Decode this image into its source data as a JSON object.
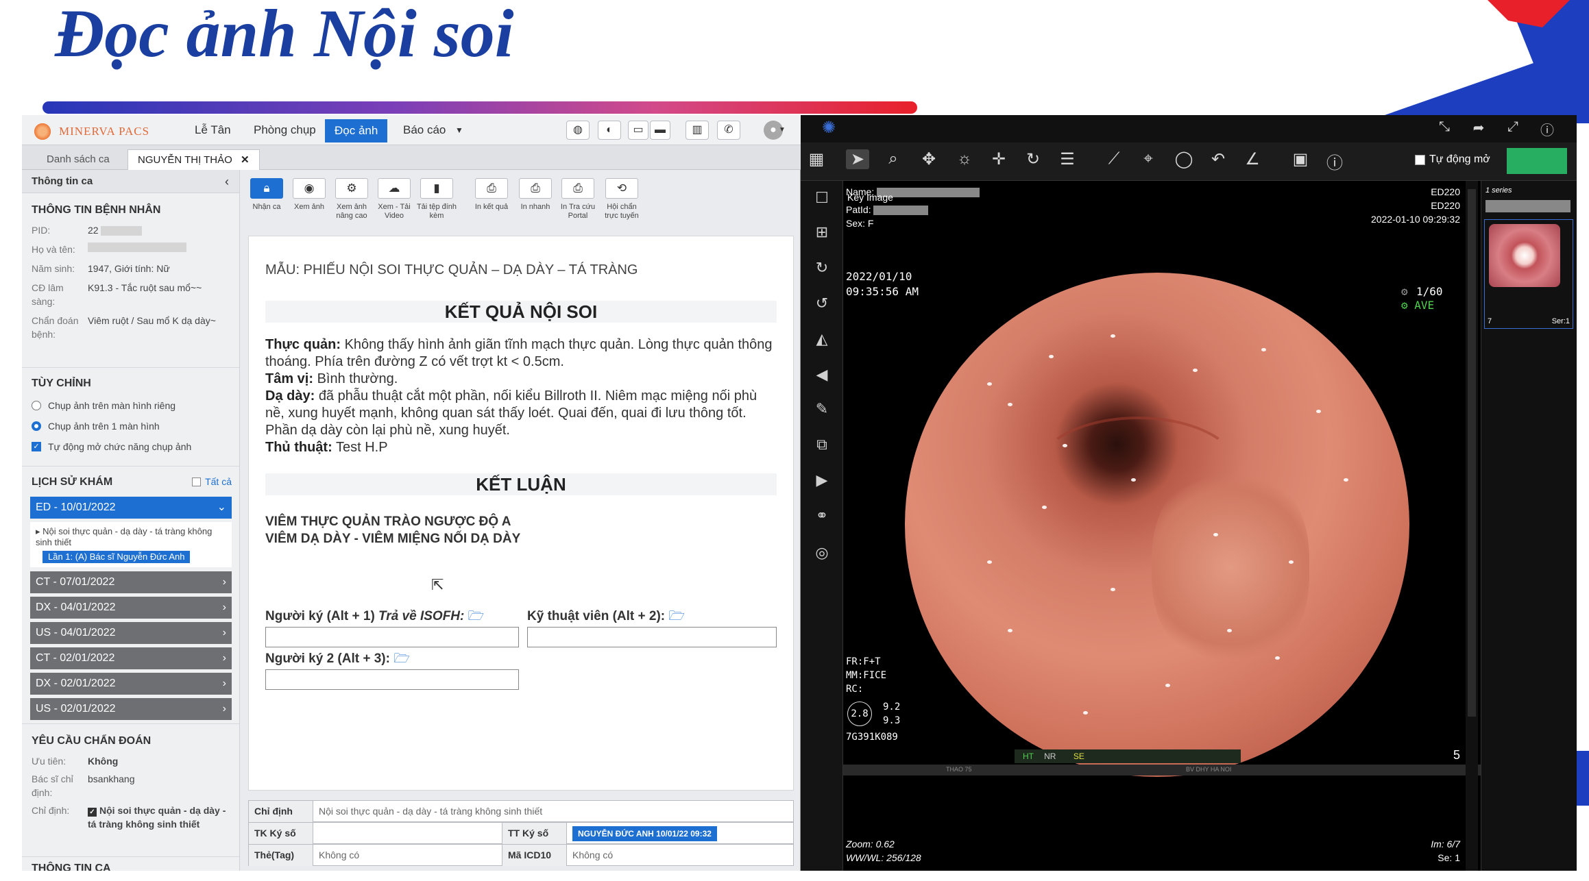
{
  "slide": {
    "title": "Đọc ảnh Nội soi"
  },
  "pacs": {
    "brand": "MINERVA PACS",
    "nav": [
      "Lễ Tân",
      "Phòng chụp",
      "Đọc ảnh",
      "Báo cáo"
    ],
    "nav_active": "Đọc ảnh",
    "tabs": {
      "list": "Danh sách ca",
      "patient": "NGUYỄN THỊ THẢO",
      "close": "✕"
    },
    "left": {
      "case_info": "Thông tin ca",
      "patient_section": "THÔNG TIN BỆNH NHÂN",
      "pid_label": "PID:",
      "pid": "22",
      "name_label": "Họ và tên:",
      "birth_label": "Năm sinh:",
      "birth": "1947, Giới tính: Nữ",
      "clin_dx_label": "CĐ lâm sàng:",
      "clin_dx": "K91.3 - Tắc ruột sau mổ~~",
      "dx_label": "Chẩn đoán bệnh:",
      "dx": "Viêm ruột / Sau mổ K dạ dày~",
      "options_section": "TÙY CHỈNH",
      "opt1": "Chụp ảnh trên màn hình riêng",
      "opt2": "Chụp ảnh trên 1 màn hình",
      "opt3": "Tự động mở chức năng chụp ảnh",
      "history_section": "LỊCH SỬ KHÁM",
      "history_all": "Tất cả",
      "history_active": "ED - 10/01/2022",
      "history_proc": "Nội soi thực quản - dạ dày - tá tràng không sinh thiết",
      "history_sub": "Lần 1: (A) Bác sĩ Nguyễn Đức Anh",
      "history": [
        "CT - 07/01/2022",
        "DX - 04/01/2022",
        "US - 04/01/2022",
        "CT - 02/01/2022",
        "DX - 02/01/2022",
        "US - 02/01/2022"
      ],
      "request_section": "YÊU CẦU CHẨN ĐOÁN",
      "priority_label": "Ưu tiên:",
      "priority": "Không",
      "doctor_label": "Bác sĩ chỉ định:",
      "doctor": "bsankhang",
      "order_label": "Chỉ định:",
      "order": "Nội soi thực quản - dạ dày - tá tràng không sinh thiết",
      "case_section": "THÔNG TIN CA"
    },
    "toolbar": [
      {
        "label": "Nhận ca",
        "icon": "lock-icon"
      },
      {
        "label": "Xem ảnh",
        "icon": "eye-icon"
      },
      {
        "label": "Xem ảnh nâng cao",
        "icon": "gear-icon"
      },
      {
        "label": "Xem - Tải Video",
        "icon": "cloud-upload-icon"
      },
      {
        "label": "Tải tệp đính kèm",
        "icon": "file-icon"
      },
      {
        "label": "In kết quả",
        "icon": "print-icon"
      },
      {
        "label": "In nhanh",
        "icon": "print-icon"
      },
      {
        "label": "In Tra cứu Portal",
        "icon": "print-icon"
      },
      {
        "label": "Hội chẩn trực tuyến",
        "icon": "sync-icon"
      }
    ],
    "report": {
      "template": "MẪU: PHIẾU NỘI SOI THỰC QUẢN – DẠ DÀY – TÁ TRÀNG",
      "result_title": "KẾT QUẢ NỘI SOI",
      "esophagus_label": "Thực quản:",
      "esophagus": "Không thấy hình ảnh giãn tĩnh mạch thực quản. Lòng thực quản thông thoáng. Phía trên đường Z có vết trợt kt < 0.5cm.",
      "cardia_label": "Tâm vị:",
      "cardia": "Bình thường.",
      "stomach_label": "Dạ dày:",
      "stomach": "đã phẫu thuật cắt một phần, nối kiểu Billroth II. Niêm mạc miệng nối phù nề, xung huyết mạnh, không quan sát thấy loét. Quai đến, quai đi lưu thông tốt. Phần dạ dày còn lại phù nề, xung huyết.",
      "procedure_label": "Thủ thuật:",
      "procedure": "Test H.P",
      "conclusion_title": "KẾT LUẬN",
      "conclusion1": "VIÊM THỰC QUẢN TRÀO NGƯỢC ĐỘ A",
      "conclusion2": "VIÊM DẠ DÀY - VIÊM MIỆNG NỐI DẠ DÀY",
      "signer1": "Người ký (Alt + 1)",
      "signer1_note": "Trả về ISOFH:",
      "tech": "Kỹ thuật viên (Alt + 2):",
      "signer2": "Người ký 2 (Alt + 3):"
    },
    "info": {
      "order_label": "Chỉ định",
      "order": "Nội soi thực quản - dạ dày - tá tràng không sinh thiết",
      "tk_label": "TK Ký số",
      "tt_label": "TT Ký số",
      "tt_value": "NGUYỄN ĐỨC ANH 10/01/22 09:32",
      "tag_label": "Thẻ(Tag)",
      "tag": "Không có",
      "icd_label": "Mã ICD10",
      "icd": "Không có"
    }
  },
  "viewer": {
    "auto_open": "Tự động mở",
    "key_image": "Key Image",
    "name_label": "Name:",
    "patid_label": "PatId:",
    "sex": "Sex: F",
    "device1": "ED220",
    "device2": "ED220",
    "datetime": "2022-01-10 09:29:32",
    "img_date": "2022/01/10",
    "img_time": "09:35:56  AM",
    "shutter": "1/60",
    "ave": "AVE",
    "fr": "FR:F+T",
    "mm": "MM:FICE",
    "rc": "RC:",
    "meter": "2.8",
    "meter_a": "9.2",
    "meter_b": "9.3",
    "serial": "7G391K089",
    "status_ht": "HT",
    "status_nr": "NR",
    "status_se": "SE",
    "frame_no": "5",
    "strip_left": "THAO 75",
    "strip_right": "BV DHY HA NOI",
    "zoom": "Zoom: 0.62",
    "wwwl": "WW/WL: 256/128",
    "im": "Im: 6/7",
    "se": "Se: 1",
    "series_count": "1 series",
    "thumb_left": "7",
    "thumb_right": "Ser:1"
  }
}
